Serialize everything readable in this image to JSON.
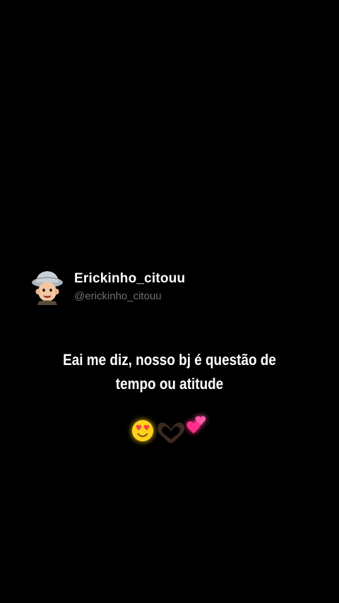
{
  "post": {
    "display_name": "Erickinho_citouu",
    "handle": "@erickinho_citouu",
    "text": "Eai me diz, nosso bj é questão de tempo ou atitude"
  },
  "emojis": [
    "smiling-face-with-heart-eyes-icon",
    "heart-hands-icon",
    "two-hearts-icon"
  ],
  "colors": {
    "background": "#000000",
    "text": "#ffffff",
    "handle": "#6f6f6f",
    "emoji_yellow": "#ffd21e",
    "emoji_pink": "#ff2d8a"
  }
}
